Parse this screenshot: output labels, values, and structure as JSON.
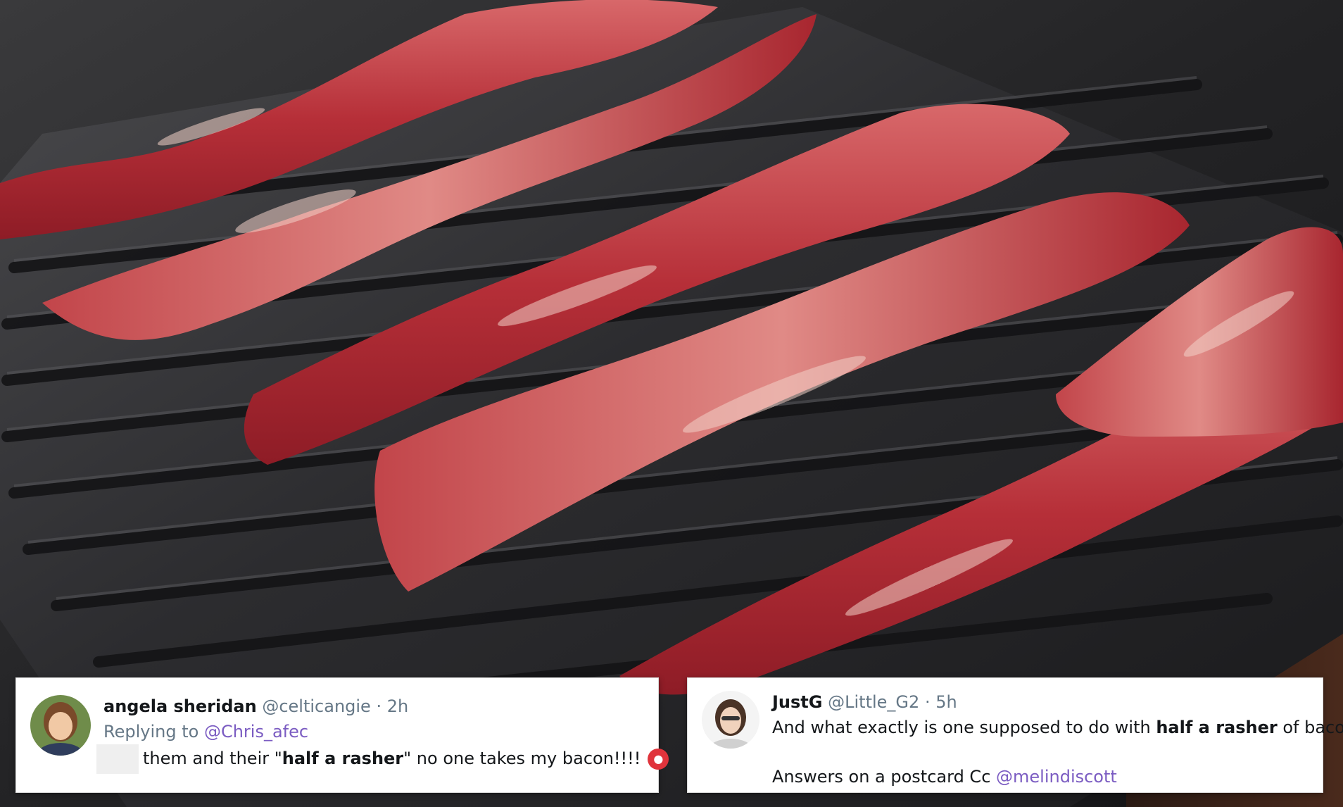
{
  "tweets": [
    {
      "name": "angela sheridan",
      "handle": "@celticangie",
      "time": "· 2h",
      "replying_label": "Replying to",
      "replying_to": "@Chris_afec",
      "text_before": "them and their \"",
      "text_bold": "half a rasher",
      "text_after": "\" no one takes my bacon!!!!",
      "emoji": "angry-face-emoji"
    },
    {
      "name": "JustG",
      "handle": "@Little_G2",
      "time": "· 5h",
      "text_before": "And what exactly is one supposed to do with ",
      "text_bold": "half a rasher",
      "text_after": " of bacon ?",
      "line2_text": "Answers on a postcard Cc ",
      "line2_mention": "@melindiscott"
    }
  ],
  "colors": {
    "mention": "#7b5cc2",
    "muted": "#657786",
    "bacon_red": "#b8323a",
    "grill": "#2b2b2d"
  }
}
